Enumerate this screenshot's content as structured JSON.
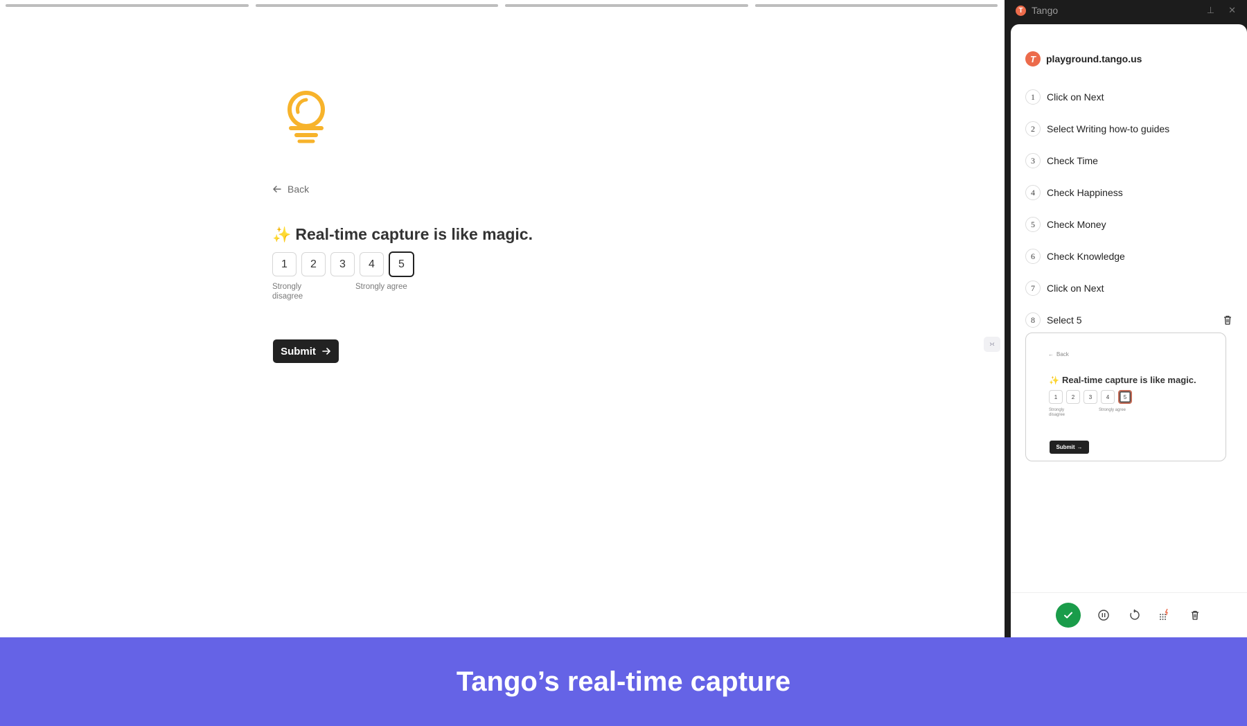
{
  "survey": {
    "progress_segments": 4,
    "back_label": "Back",
    "question": "Real-time capture is like magic.",
    "sparkle": "✨",
    "options": [
      "1",
      "2",
      "3",
      "4",
      "5"
    ],
    "selected_option": "5",
    "label_low": "Strongly disagree",
    "label_high": "Strongly agree",
    "submit_label": "Submit",
    "accent_color": "#f7b32b"
  },
  "tango": {
    "window_title": "Tango",
    "logo_letter": "T",
    "site": "playground.tango.us",
    "steps": [
      {
        "num": "1",
        "label": "Click on Next"
      },
      {
        "num": "2",
        "label": "Select Writing how-to guides"
      },
      {
        "num": "3",
        "label": "Check Time"
      },
      {
        "num": "4",
        "label": "Check Happiness"
      },
      {
        "num": "5",
        "label": "Check Money"
      },
      {
        "num": "6",
        "label": "Check Knowledge"
      },
      {
        "num": "7",
        "label": "Click on Next"
      },
      {
        "num": "8",
        "label": "Select 5"
      }
    ],
    "preview": {
      "back_label": "Back",
      "question": "Real-time capture is like magic.",
      "options": [
        "1",
        "2",
        "3",
        "4",
        "5"
      ],
      "label_low": "Strongly disagree",
      "label_high": "Strongly agree",
      "submit_label": "Submit"
    },
    "brand_color": "#ec6b4b",
    "done_color": "#1a9c4a"
  },
  "banner": {
    "text": "Tango’s real-time capture",
    "color": "#6563e6"
  }
}
